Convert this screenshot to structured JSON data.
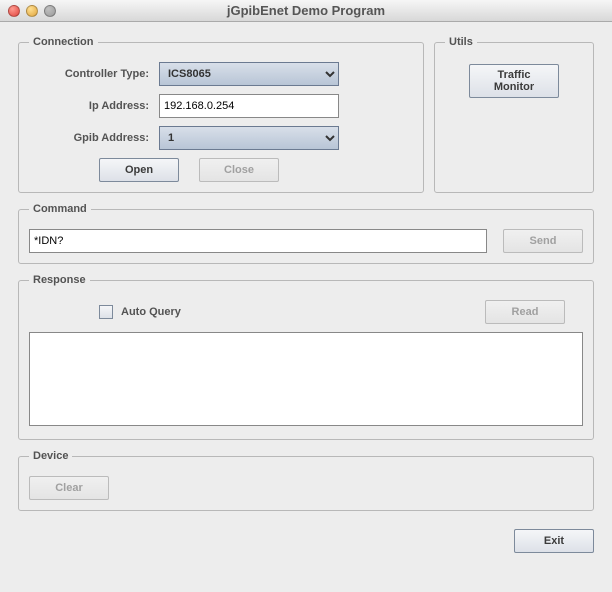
{
  "window": {
    "title": "jGpibEnet Demo Program"
  },
  "connection": {
    "legend": "Connection",
    "controllerLabel": "Controller Type:",
    "controllerValue": "ICS8065",
    "ipLabel": "Ip Address:",
    "ipValue": "192.168.0.254",
    "gpibLabel": "Gpib Address:",
    "gpibValue": "1",
    "openLabel": "Open",
    "closeLabel": "Close"
  },
  "utils": {
    "legend": "Utils",
    "trafficMonitorLine1": "Traffic",
    "trafficMonitorLine2": "Monitor"
  },
  "command": {
    "legend": "Command",
    "value": "*IDN?",
    "sendLabel": "Send"
  },
  "response": {
    "legend": "Response",
    "autoQueryLabel": "Auto Query",
    "readLabel": "Read",
    "value": ""
  },
  "device": {
    "legend": "Device",
    "clearLabel": "Clear"
  },
  "footer": {
    "exitLabel": "Exit"
  }
}
